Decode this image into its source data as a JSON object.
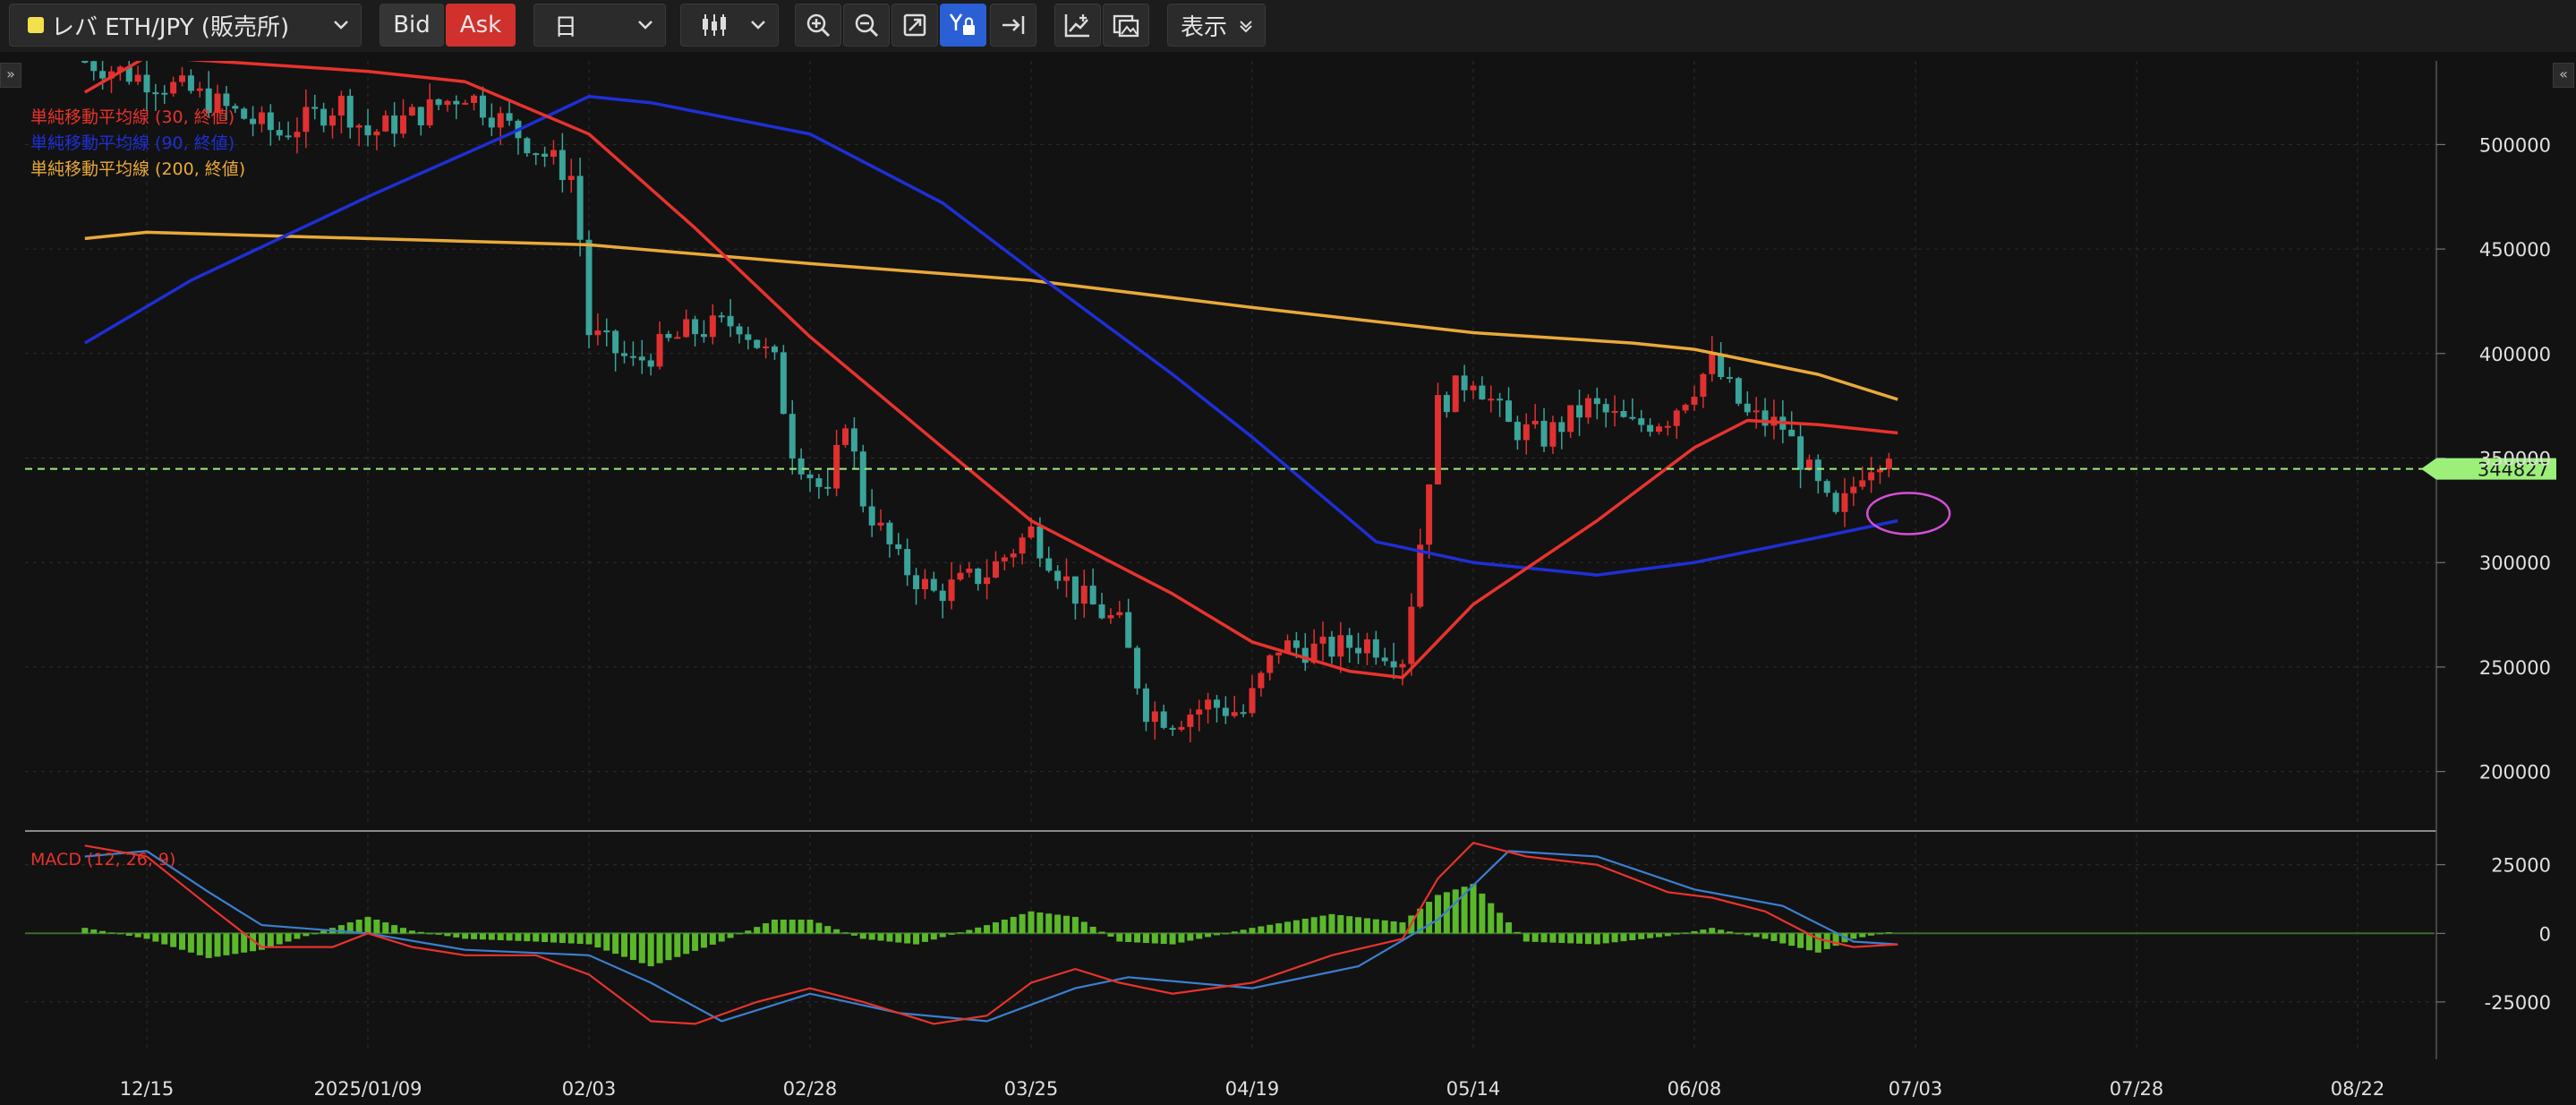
{
  "toolbar": {
    "symbol": "レバ ETH/JPY (販売所)",
    "bid_label": "Bid",
    "ask_label": "Ask",
    "timeframe": "日",
    "display_label": "表示"
  },
  "colors": {
    "sma30": "#e8332c",
    "sma90": "#1e2fd6",
    "sma200": "#e9a93a",
    "candle_up": "#e03030",
    "candle_down": "#3aa39a",
    "macd": "#e8332c",
    "signal": "#3b7fd0",
    "histogram": "#5ab82a",
    "current_price": "#9cf07a",
    "highlight_ellipse": "#d64fd6"
  },
  "chart_data": [
    {
      "type": "candlestick",
      "panel": "price",
      "legend": [
        {
          "name": "単純移動平均線 (30, 終値)",
          "color": "#e8332c"
        },
        {
          "name": "単純移動平均線 (90, 終値)",
          "color": "#1e2fd6"
        },
        {
          "name": "単純移動平均線 (200, 終値)",
          "color": "#e9a93a"
        }
      ],
      "x_ticks": [
        "12/15",
        "2025/01/09",
        "02/03",
        "02/28",
        "03/25",
        "04/19",
        "05/14",
        "06/08",
        "07/03",
        "07/28",
        "08/22"
      ],
      "y_ticks": [
        200000,
        250000,
        300000,
        350000,
        400000,
        450000,
        500000
      ],
      "ylim": [
        175000,
        540000
      ],
      "current_price": 344827,
      "current_price_label": "344827",
      "close_series": [
        [
          "12/08",
          540000
        ],
        [
          "12/20",
          525000
        ],
        [
          "12/30",
          505000
        ],
        [
          "01/06",
          520000
        ],
        [
          "01/09",
          505000
        ],
        [
          "01/15",
          515000
        ],
        [
          "01/20",
          525000
        ],
        [
          "01/26",
          505000
        ],
        [
          "02/01",
          485000
        ],
        [
          "02/02",
          455000
        ],
        [
          "02/03",
          410000
        ],
        [
          "02/08",
          395000
        ],
        [
          "02/14",
          410000
        ],
        [
          "02/20",
          415000
        ],
        [
          "02/24",
          395000
        ],
        [
          "02/26",
          355000
        ],
        [
          "03/02",
          330000
        ],
        [
          "03/04",
          370000
        ],
        [
          "03/06",
          330000
        ],
        [
          "03/10",
          300000
        ],
        [
          "03/14",
          285000
        ],
        [
          "03/20",
          295000
        ],
        [
          "03/25",
          315000
        ],
        [
          "03/30",
          285000
        ],
        [
          "04/04",
          270000
        ],
        [
          "04/07",
          230000
        ],
        [
          "04/10",
          225000
        ],
        [
          "04/14",
          232000
        ],
        [
          "04/18",
          228000
        ],
        [
          "04/22",
          260000
        ],
        [
          "04/27",
          258000
        ],
        [
          "05/02",
          262000
        ],
        [
          "05/06",
          255000
        ],
        [
          "05/08",
          310000
        ],
        [
          "05/10",
          375000
        ],
        [
          "05/14",
          390000
        ],
        [
          "05/18",
          365000
        ],
        [
          "05/22",
          360000
        ],
        [
          "05/27",
          375000
        ],
        [
          "06/01",
          365000
        ],
        [
          "06/05",
          370000
        ],
        [
          "06/10",
          395000
        ],
        [
          "06/14",
          370000
        ],
        [
          "06/18",
          365000
        ],
        [
          "06/22",
          335000
        ],
        [
          "06/24",
          320000
        ],
        [
          "06/27",
          345000
        ],
        [
          "06/30",
          355000
        ],
        [
          "07/01",
          345000
        ]
      ],
      "series": [
        {
          "name": "単純移動平均線 (30, 終値)",
          "values": [
            [
              "12/08",
              525000
            ],
            [
              "12/15",
              542000
            ],
            [
              "01/09",
              535000
            ],
            [
              "01/20",
              530000
            ],
            [
              "02/03",
              505000
            ],
            [
              "02/15",
              460000
            ],
            [
              "02/28",
              408000
            ],
            [
              "03/15",
              355000
            ],
            [
              "03/25",
              320000
            ],
            [
              "04/10",
              285000
            ],
            [
              "04/19",
              262000
            ],
            [
              "04/30",
              248000
            ],
            [
              "05/06",
              245000
            ],
            [
              "05/14",
              280000
            ],
            [
              "05/28",
              320000
            ],
            [
              "06/08",
              355000
            ],
            [
              "06/14",
              368000
            ],
            [
              "06/22",
              366000
            ],
            [
              "07/01",
              362000
            ]
          ]
        },
        {
          "name": "単純移動平均線 (90, 終値)",
          "values": [
            [
              "12/08",
              405000
            ],
            [
              "12/20",
              435000
            ],
            [
              "01/09",
              475000
            ],
            [
              "01/25",
              505000
            ],
            [
              "02/03",
              523000
            ],
            [
              "02/10",
              520000
            ],
            [
              "02/28",
              505000
            ],
            [
              "03/15",
              472000
            ],
            [
              "03/25",
              440000
            ],
            [
              "04/10",
              390000
            ],
            [
              "04/19",
              360000
            ],
            [
              "05/03",
              310000
            ],
            [
              "05/14",
              300000
            ],
            [
              "05/28",
              294000
            ],
            [
              "06/08",
              300000
            ],
            [
              "06/22",
              312000
            ],
            [
              "07/01",
              320000
            ]
          ]
        },
        {
          "name": "単純移動平均線 (200, 終値)",
          "values": [
            [
              "12/08",
              455000
            ],
            [
              "12/15",
              458000
            ],
            [
              "01/09",
              455000
            ],
            [
              "02/03",
              452000
            ],
            [
              "02/28",
              443000
            ],
            [
              "03/25",
              435000
            ],
            [
              "04/19",
              422000
            ],
            [
              "05/14",
              410000
            ],
            [
              "06/01",
              405000
            ],
            [
              "06/08",
              402000
            ],
            [
              "06/22",
              390000
            ],
            [
              "07/01",
              378000
            ]
          ]
        }
      ]
    },
    {
      "type": "line",
      "panel": "macd",
      "title": "MACD (12, 26, 9)",
      "y_ticks": [
        -25000,
        0,
        25000
      ],
      "ylim": [
        -42000,
        36000
      ],
      "series": [
        {
          "name": "MACD",
          "values": [
            [
              "12/08",
              32000
            ],
            [
              "12/15",
              28000
            ],
            [
              "12/22",
              10000
            ],
            [
              "12/28",
              -5000
            ],
            [
              "01/05",
              -5000
            ],
            [
              "01/09",
              0
            ],
            [
              "01/14",
              -5000
            ],
            [
              "01/20",
              -8000
            ],
            [
              "01/28",
              -8000
            ],
            [
              "02/03",
              -15000
            ],
            [
              "02/10",
              -32000
            ],
            [
              "02/15",
              -33000
            ],
            [
              "02/22",
              -25000
            ],
            [
              "02/28",
              -20000
            ],
            [
              "03/06",
              -25000
            ],
            [
              "03/14",
              -33000
            ],
            [
              "03/20",
              -30000
            ],
            [
              "03/25",
              -18000
            ],
            [
              "03/30",
              -13000
            ],
            [
              "04/04",
              -18000
            ],
            [
              "04/10",
              -22000
            ],
            [
              "04/19",
              -18000
            ],
            [
              "04/28",
              -8000
            ],
            [
              "05/06",
              -2000
            ],
            [
              "05/10",
              20000
            ],
            [
              "05/14",
              33000
            ],
            [
              "05/20",
              28000
            ],
            [
              "05/28",
              25000
            ],
            [
              "06/05",
              15000
            ],
            [
              "06/10",
              13000
            ],
            [
              "06/16",
              8000
            ],
            [
              "06/22",
              -2000
            ],
            [
              "06/26",
              -5000
            ],
            [
              "07/01",
              -4000
            ]
          ]
        },
        {
          "name": "Signal",
          "values": [
            [
              "12/08",
              28000
            ],
            [
              "12/15",
              30000
            ],
            [
              "12/22",
              15000
            ],
            [
              "12/28",
              3000
            ],
            [
              "01/09",
              0
            ],
            [
              "01/20",
              -6000
            ],
            [
              "02/03",
              -8000
            ],
            [
              "02/10",
              -18000
            ],
            [
              "02/18",
              -32000
            ],
            [
              "02/28",
              -22000
            ],
            [
              "03/10",
              -29000
            ],
            [
              "03/20",
              -32000
            ],
            [
              "03/30",
              -20000
            ],
            [
              "04/05",
              -16000
            ],
            [
              "04/19",
              -20000
            ],
            [
              "05/01",
              -12000
            ],
            [
              "05/10",
              5000
            ],
            [
              "05/18",
              30000
            ],
            [
              "05/28",
              28000
            ],
            [
              "06/08",
              16000
            ],
            [
              "06/18",
              10000
            ],
            [
              "06/26",
              -3000
            ],
            [
              "07/01",
              -4000
            ]
          ]
        },
        {
          "name": "Histogram",
          "values": [
            [
              "12/08",
              2000
            ],
            [
              "12/15",
              -2000
            ],
            [
              "12/22",
              -9000
            ],
            [
              "12/28",
              -6000
            ],
            [
              "01/05",
              2000
            ],
            [
              "01/09",
              6000
            ],
            [
              "01/14",
              1000
            ],
            [
              "01/20",
              -2000
            ],
            [
              "01/28",
              -3000
            ],
            [
              "02/03",
              -4000
            ],
            [
              "02/10",
              -12000
            ],
            [
              "02/18",
              -3000
            ],
            [
              "02/24",
              5000
            ],
            [
              "02/28",
              5000
            ],
            [
              "03/06",
              -2000
            ],
            [
              "03/12",
              -4000
            ],
            [
              "03/20",
              3000
            ],
            [
              "03/25",
              8000
            ],
            [
              "03/30",
              6000
            ],
            [
              "04/04",
              -3000
            ],
            [
              "04/10",
              -4000
            ],
            [
              "04/19",
              2000
            ],
            [
              "04/28",
              7000
            ],
            [
              "05/06",
              4000
            ],
            [
              "05/10",
              14000
            ],
            [
              "05/14",
              18000
            ],
            [
              "05/20",
              -3000
            ],
            [
              "05/28",
              -4000
            ],
            [
              "06/05",
              -1000
            ],
            [
              "06/10",
              2000
            ],
            [
              "06/16",
              -2000
            ],
            [
              "06/22",
              -7000
            ],
            [
              "06/26",
              -2000
            ],
            [
              "07/01",
              1000
            ]
          ]
        }
      ]
    }
  ]
}
